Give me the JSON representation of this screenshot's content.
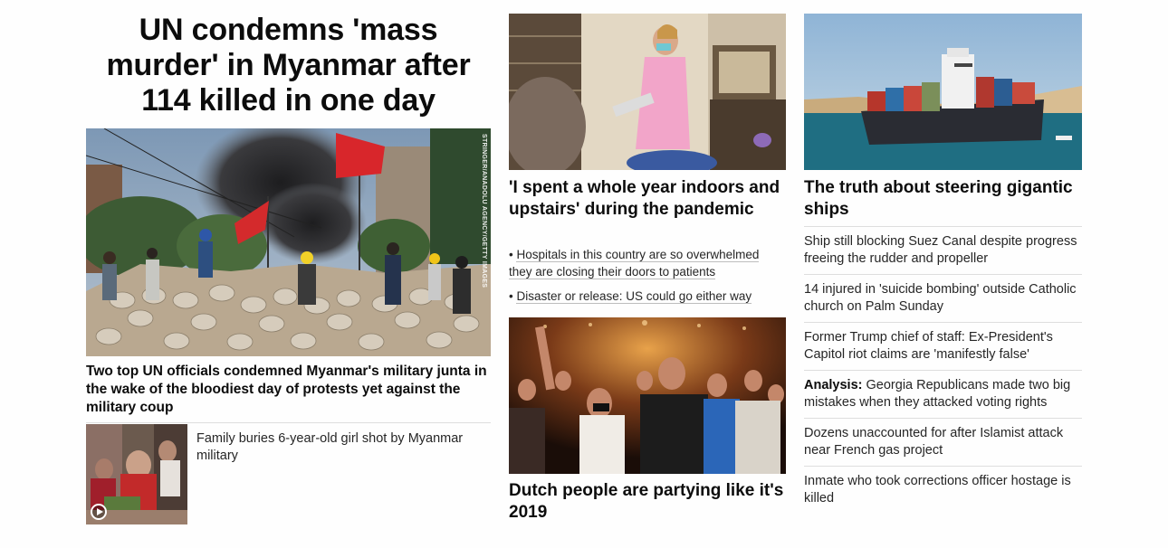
{
  "hero": {
    "title": "UN condemns 'mass murder' in Myanmar after 114 killed in one day",
    "image_credit": "STRINGER/ANADOLU AGENCY/GETTY IMAGES",
    "summary": "Two top UN officials condemned Myanmar's military junta in the wake of the bloodiest day of protests yet against the military coup",
    "related": {
      "caption": "Family buries 6-year-old girl shot by Myanmar military",
      "media": "play-icon"
    }
  },
  "middle": {
    "story1": {
      "title": "'I spent a whole year indoors and upstairs' during the pandemic",
      "bullets": [
        "Hospitals in this country are so overwhelmed they are closing their doors to patients",
        "Disaster or release: US could go either way"
      ]
    },
    "story2": {
      "title": "Dutch people are partying like it's 2019"
    }
  },
  "right": {
    "title": "The truth about steering gigantic ships",
    "items": [
      {
        "prefix": "",
        "text": "Ship still blocking Suez Canal despite progress freeing the rudder and propeller"
      },
      {
        "prefix": "",
        "text": "14 injured in 'suicide bombing' outside Catholic church on Palm Sunday"
      },
      {
        "prefix": "",
        "text": "Former Trump chief of staff: Ex-President's Capitol riot claims are 'manifestly false'"
      },
      {
        "prefix": "Analysis:",
        "text": " Georgia Republicans made two big mistakes when they attacked voting rights"
      },
      {
        "prefix": "",
        "text": "Dozens unaccounted for after Islamist attack near French gas project"
      },
      {
        "prefix": "",
        "text": "Inmate who took corrections officer hostage is killed"
      }
    ]
  }
}
